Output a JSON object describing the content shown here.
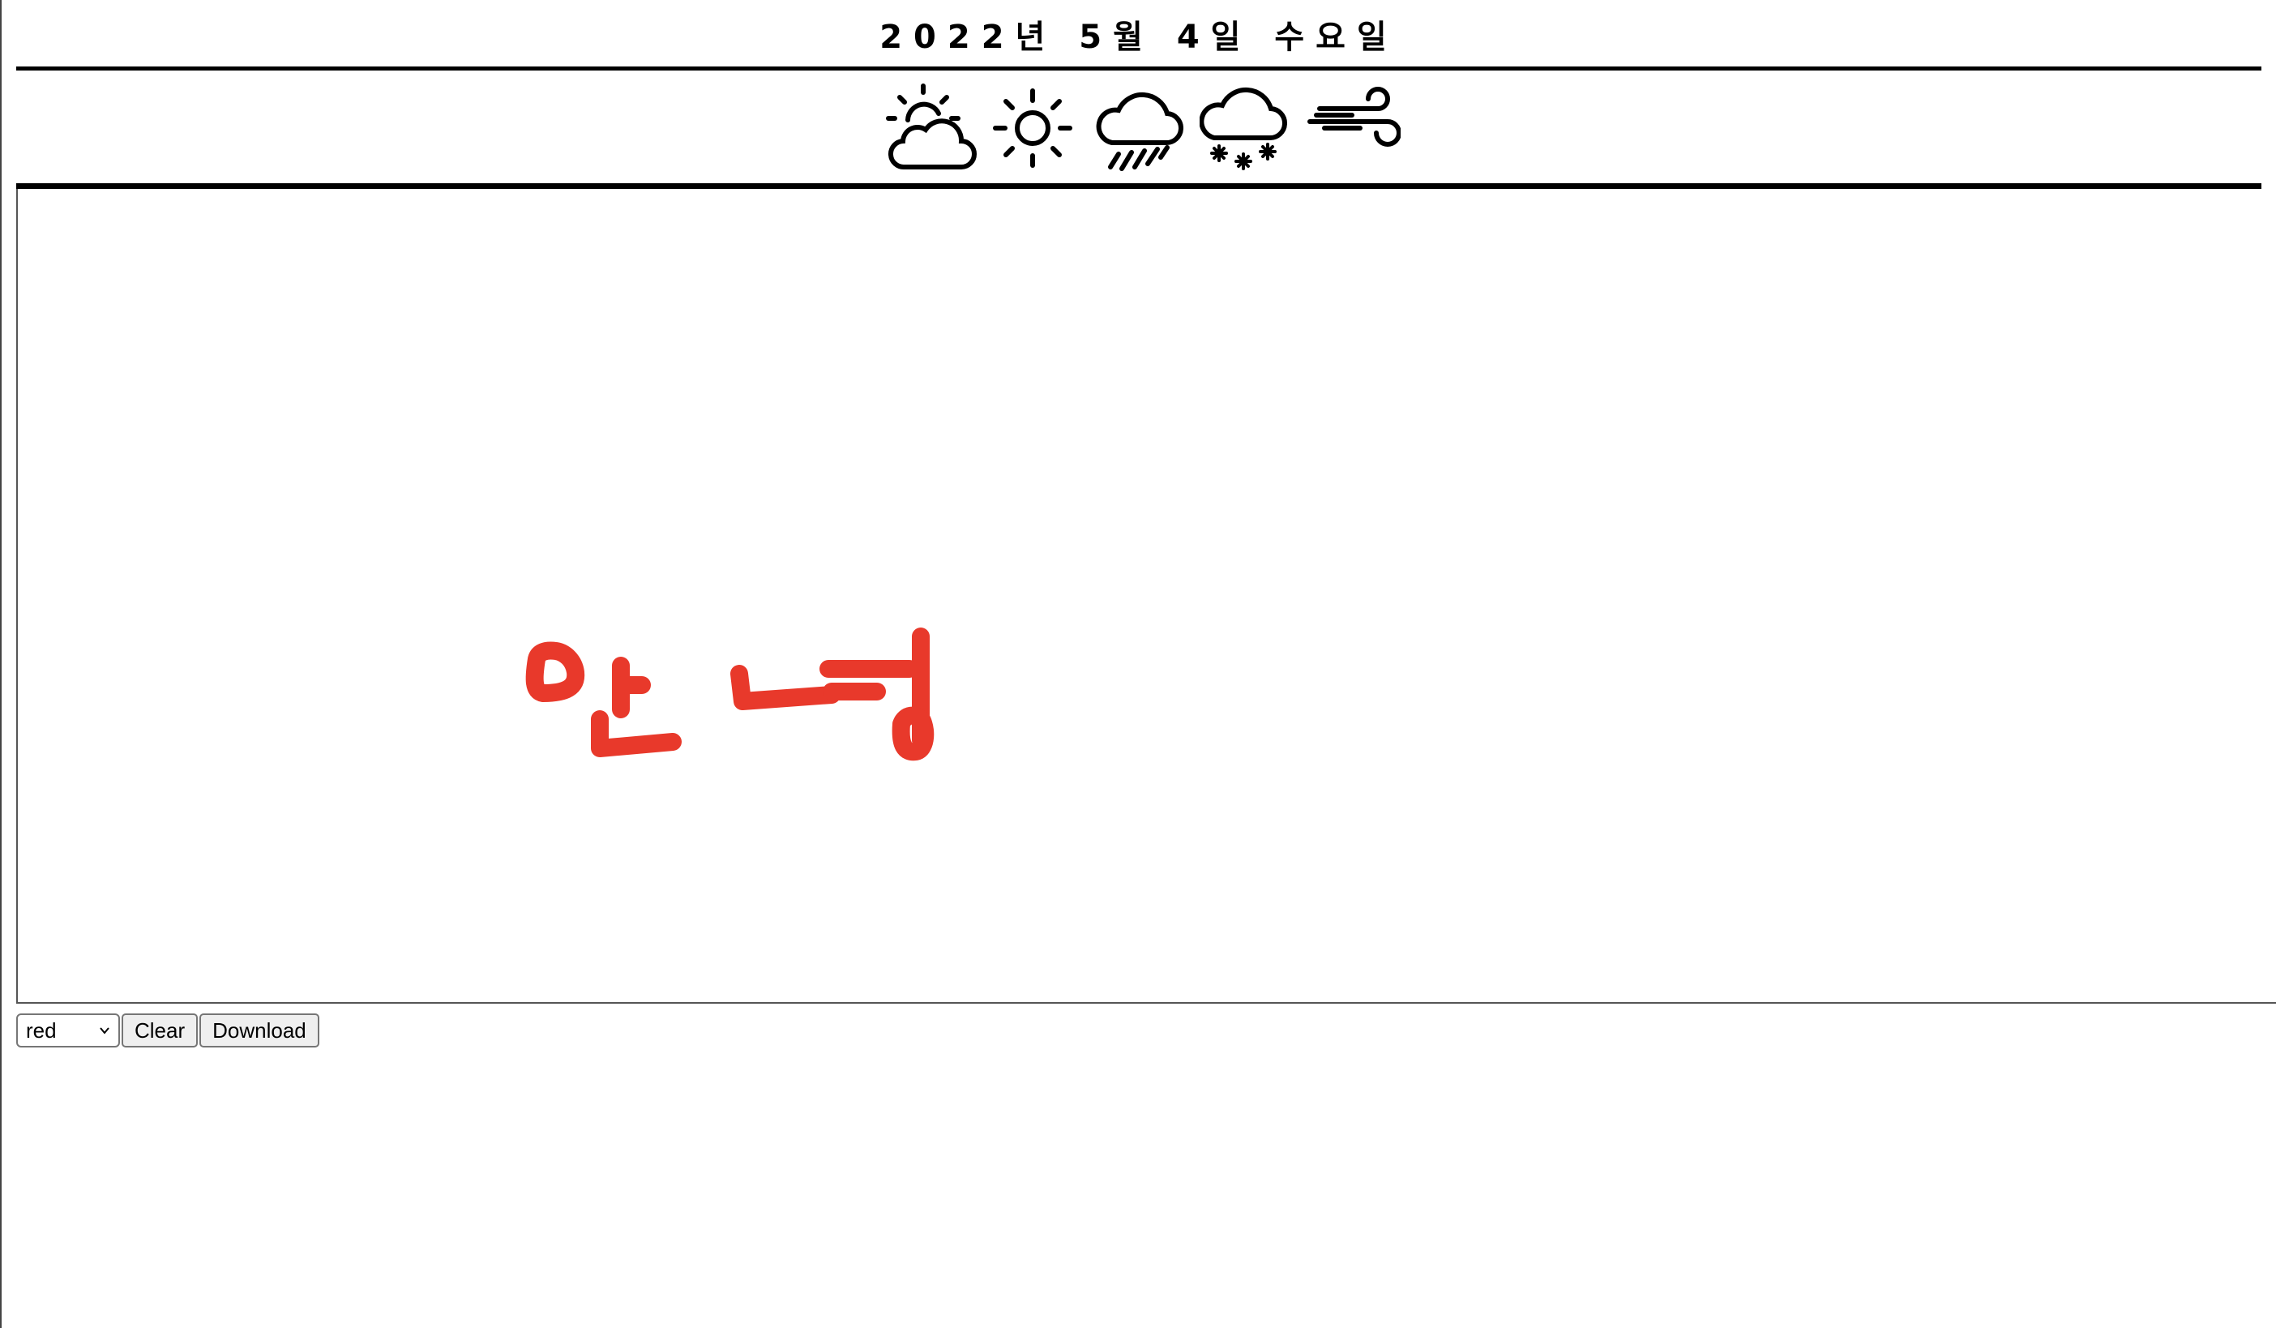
{
  "header": {
    "date": "2022년 5월 4일 수요일"
  },
  "weather_icons": [
    {
      "icon": "partly-cloudy-icon"
    },
    {
      "icon": "sunny-icon"
    },
    {
      "icon": "rain-icon"
    },
    {
      "icon": "snow-icon"
    },
    {
      "icon": "wind-icon"
    }
  ],
  "canvas": {
    "stroke_color": "#e8392b",
    "drawn_text": "안녕"
  },
  "controls": {
    "color_select_value": "red",
    "clear_label": "Clear",
    "download_label": "Download"
  }
}
